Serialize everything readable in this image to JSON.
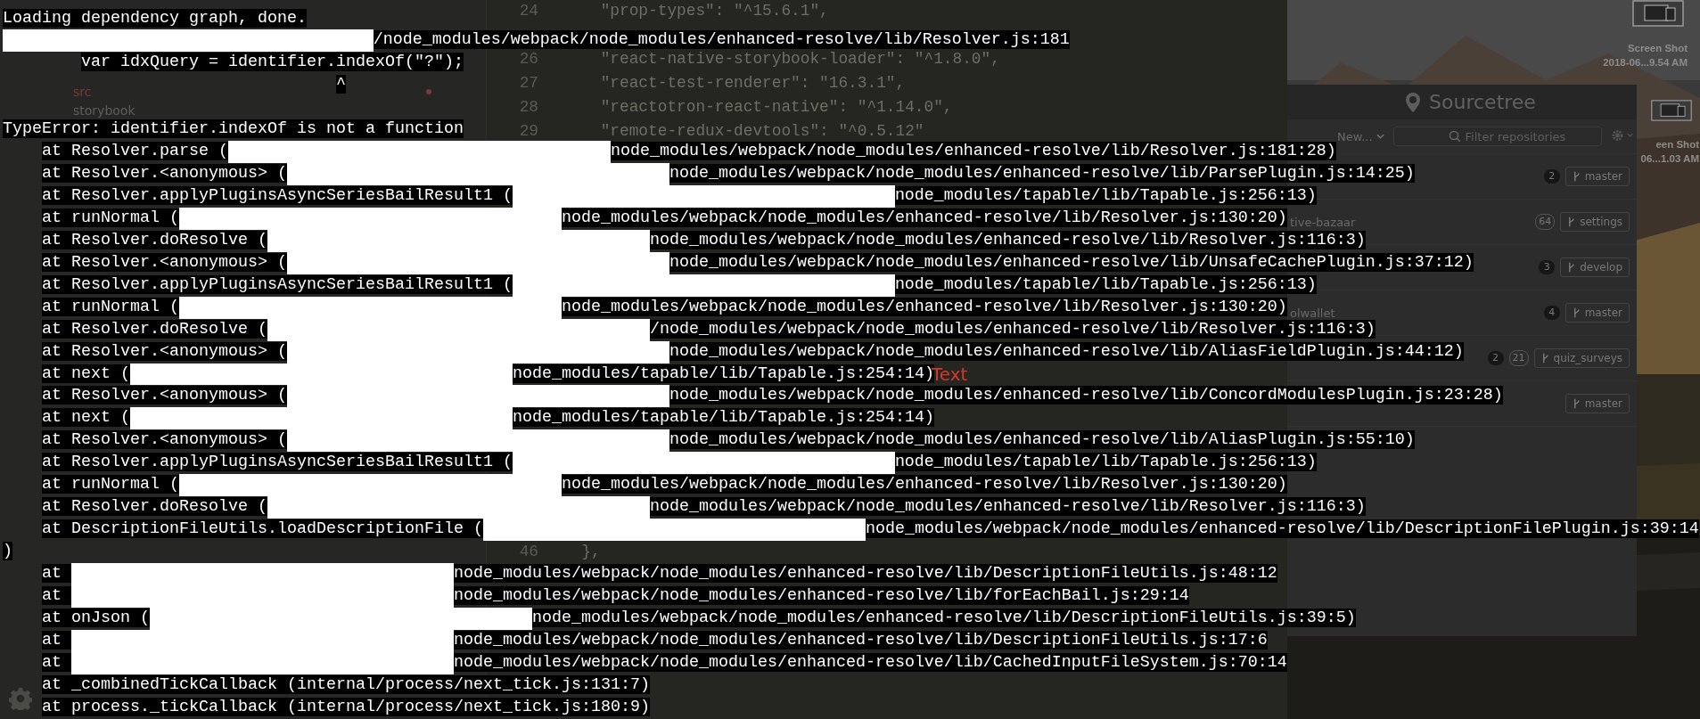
{
  "editor": {
    "file_tree": [
      {
        "name": "src",
        "modified": true
      },
      {
        "name": "storybook",
        "modified": false
      }
    ],
    "lines": [
      {
        "number": "24",
        "code": "    \"prop-types\": \"^15.6.1\","
      },
      {
        "number": "26",
        "code": "    \"react-native-storybook-loader\": \"^1.8.0\","
      },
      {
        "number": "27",
        "code": "    \"react-test-renderer\": \"16.3.1\","
      },
      {
        "number": "28",
        "code": "    \"reactotron-react-native\": \"^1.14.0\","
      },
      {
        "number": "29",
        "code": "    \"remote-redux-devtools\": \"^0.5.12\""
      }
    ],
    "lines_lower": [
      {
        "number": "46",
        "code": "  },"
      }
    ]
  },
  "desktop": {
    "files": [
      {
        "labels": [
          "Screen Shot",
          "2018-06...9.54 AM"
        ]
      },
      {
        "labels": [
          "een Shot",
          "06...1.03 AM"
        ]
      }
    ]
  },
  "sourcetree": {
    "title": "Sourcetree",
    "new_button": "New...",
    "search": {
      "placeholder": "Filter repositories"
    },
    "repositories": [
      {
        "badges": [
          {
            "kind": "filled",
            "text": "2"
          }
        ],
        "branch": "master"
      },
      {
        "name": "tive-bazaar",
        "badges": [
          {
            "kind": "outlined",
            "text": "64"
          }
        ],
        "branch": "settings"
      },
      {
        "badges": [
          {
            "kind": "filled",
            "text": "3"
          }
        ],
        "branch": "develop"
      },
      {
        "name": "olwallet",
        "badges": [
          {
            "kind": "filled",
            "text": "4"
          }
        ],
        "branch": "master"
      },
      {
        "badges": [
          {
            "kind": "filled",
            "text": "2"
          },
          {
            "kind": "outlined",
            "text": "21"
          }
        ],
        "branch": "quiz_surveys"
      },
      {
        "branch": "master"
      }
    ]
  },
  "terminal": {
    "lines": [
      {
        "kind": "output",
        "segments": [
          {
            "kind": "text",
            "text": "Loading dependency graph, done."
          }
        ]
      },
      {
        "kind": "output",
        "segments": [
          {
            "kind": "redacted"
          },
          {
            "kind": "text",
            "text": "/node_modules/webpack/node_modules/enhanced-resolve/lib/Resolver.js:181"
          }
        ]
      },
      {
        "kind": "output",
        "segments": [
          {
            "kind": "text",
            "text": "        var idxQuery = identifier.indexOf(\"?\");"
          }
        ]
      },
      {
        "kind": "output",
        "segments": [
          {
            "kind": "text",
            "text": "                                  ^"
          }
        ]
      },
      {
        "kind": "blank"
      },
      {
        "kind": "output",
        "segments": [
          {
            "kind": "text",
            "text": "TypeError: identifier.indexOf is not a function"
          }
        ]
      },
      {
        "kind": "output",
        "segments": [
          {
            "kind": "text",
            "text": "    at Resolver.parse ("
          },
          {
            "kind": "redacted"
          },
          {
            "kind": "text",
            "text": "node_modules/webpack/node_modules/enhanced-resolve/lib/Resolver.js:181:28)"
          }
        ]
      },
      {
        "kind": "output",
        "segments": [
          {
            "kind": "text",
            "text": "    at Resolver.<anonymous> ("
          },
          {
            "kind": "redacted"
          },
          {
            "kind": "text",
            "text": "node_modules/webpack/node_modules/enhanced-resolve/lib/ParsePlugin.js:14:25)"
          }
        ]
      },
      {
        "kind": "output",
        "segments": [
          {
            "kind": "text",
            "text": "    at Resolver.applyPluginsAsyncSeriesBailResult1 ("
          },
          {
            "kind": "redacted"
          },
          {
            "kind": "text",
            "text": "node_modules/tapable/lib/Tapable.js:256:13)"
          }
        ]
      },
      {
        "kind": "output",
        "segments": [
          {
            "kind": "text",
            "text": "    at runNormal ("
          },
          {
            "kind": "redacted"
          },
          {
            "kind": "text",
            "text": "node_modules/webpack/node_modules/enhanced-resolve/lib/Resolver.js:130:20)"
          }
        ]
      },
      {
        "kind": "output",
        "segments": [
          {
            "kind": "text",
            "text": "    at Resolver.doResolve ("
          },
          {
            "kind": "redacted"
          },
          {
            "kind": "text",
            "text": "node_modules/webpack/node_modules/enhanced-resolve/lib/Resolver.js:116:3)"
          }
        ]
      },
      {
        "kind": "output",
        "segments": [
          {
            "kind": "text",
            "text": "    at Resolver.<anonymous> ("
          },
          {
            "kind": "redacted"
          },
          {
            "kind": "text",
            "text": "node_modules/webpack/node_modules/enhanced-resolve/lib/UnsafeCachePlugin.js:37:12)"
          }
        ]
      },
      {
        "kind": "output",
        "segments": [
          {
            "kind": "text",
            "text": "    at Resolver.applyPluginsAsyncSeriesBailResult1 ("
          },
          {
            "kind": "redacted"
          },
          {
            "kind": "text",
            "text": "node_modules/tapable/lib/Tapable.js:256:13)"
          }
        ]
      },
      {
        "kind": "output",
        "segments": [
          {
            "kind": "text",
            "text": "    at runNormal ("
          },
          {
            "kind": "redacted"
          },
          {
            "kind": "text",
            "text": "node_modules/webpack/node_modules/enhanced-resolve/lib/Resolver.js:130:20)"
          }
        ]
      },
      {
        "kind": "output",
        "segments": [
          {
            "kind": "text",
            "text": "    at Resolver.doResolve ("
          },
          {
            "kind": "redacted"
          },
          {
            "kind": "text",
            "text": "/node_modules/webpack/node_modules/enhanced-resolve/lib/Resolver.js:116:3)"
          }
        ]
      },
      {
        "kind": "output",
        "segments": [
          {
            "kind": "text",
            "text": "    at Resolver.<anonymous> ("
          },
          {
            "kind": "redacted"
          },
          {
            "kind": "text",
            "text": "node_modules/webpack/node_modules/enhanced-resolve/lib/AliasFieldPlugin.js:44:12)"
          }
        ]
      },
      {
        "kind": "output",
        "segments": [
          {
            "kind": "text",
            "text": "    at next ("
          },
          {
            "kind": "redacted"
          },
          {
            "kind": "text",
            "text": "node_modules/tapable/lib/Tapable.js:254:14)"
          }
        ]
      },
      {
        "kind": "output",
        "segments": [
          {
            "kind": "text",
            "text": "    at Resolver.<anonymous> ("
          },
          {
            "kind": "redacted"
          },
          {
            "kind": "text",
            "text": "node_modules/webpack/node_modules/enhanced-resolve/lib/ConcordModulesPlugin.js:23:28)"
          }
        ]
      },
      {
        "kind": "output",
        "segments": [
          {
            "kind": "text",
            "text": "    at next ("
          },
          {
            "kind": "redacted"
          },
          {
            "kind": "text",
            "text": "node_modules/tapable/lib/Tapable.js:254:14)"
          }
        ]
      },
      {
        "kind": "output",
        "segments": [
          {
            "kind": "text",
            "text": "    at Resolver.<anonymous> ("
          },
          {
            "kind": "redacted"
          },
          {
            "kind": "text",
            "text": "node_modules/webpack/node_modules/enhanced-resolve/lib/AliasPlugin.js:55:10)"
          }
        ]
      },
      {
        "kind": "output",
        "segments": [
          {
            "kind": "text",
            "text": "    at Resolver.applyPluginsAsyncSeriesBailResult1 ("
          },
          {
            "kind": "redacted"
          },
          {
            "kind": "text",
            "text": "node_modules/tapable/lib/Tapable.js:256:13)"
          }
        ]
      },
      {
        "kind": "output",
        "segments": [
          {
            "kind": "text",
            "text": "    at runNormal ("
          },
          {
            "kind": "redacted"
          },
          {
            "kind": "text",
            "text": "node_modules/webpack/node_modules/enhanced-resolve/lib/Resolver.js:130:20)"
          }
        ]
      },
      {
        "kind": "output",
        "segments": [
          {
            "kind": "text",
            "text": "    at Resolver.doResolve ("
          },
          {
            "kind": "redacted"
          },
          {
            "kind": "text",
            "text": "node_modules/webpack/node_modules/enhanced-resolve/lib/Resolver.js:116:3)"
          }
        ]
      },
      {
        "kind": "output",
        "segments": [
          {
            "kind": "text",
            "text": "    at DescriptionFileUtils.loadDescriptionFile ("
          },
          {
            "kind": "redacted"
          },
          {
            "kind": "text",
            "text": "node_modules/webpack/node_modules/enhanced-resolve/lib/DescriptionFilePlugin.js:39:14"
          }
        ]
      },
      {
        "kind": "output",
        "segments": [
          {
            "kind": "text",
            "text": ")"
          }
        ]
      },
      {
        "kind": "output",
        "segments": [
          {
            "kind": "text",
            "text": "    at "
          },
          {
            "kind": "redacted"
          },
          {
            "kind": "text",
            "text": "node_modules/webpack/node_modules/enhanced-resolve/lib/DescriptionFileUtils.js:48:12"
          }
        ]
      },
      {
        "kind": "output",
        "segments": [
          {
            "kind": "text",
            "text": "    at "
          },
          {
            "kind": "redacted"
          },
          {
            "kind": "text",
            "text": "node_modules/webpack/node_modules/enhanced-resolve/lib/forEachBail.js:29:14"
          }
        ]
      },
      {
        "kind": "output",
        "segments": [
          {
            "kind": "text",
            "text": "    at onJson ("
          },
          {
            "kind": "redacted"
          },
          {
            "kind": "text",
            "text": "node_modules/webpack/node_modules/enhanced-resolve/lib/DescriptionFileUtils.js:39:5)"
          }
        ]
      },
      {
        "kind": "output",
        "segments": [
          {
            "kind": "text",
            "text": "    at "
          },
          {
            "kind": "redacted"
          },
          {
            "kind": "text",
            "text": "node_modules/webpack/node_modules/enhanced-resolve/lib/DescriptionFileUtils.js:17:6"
          }
        ]
      },
      {
        "kind": "output",
        "segments": [
          {
            "kind": "text",
            "text": "    at "
          },
          {
            "kind": "redacted"
          },
          {
            "kind": "text",
            "text": "node_modules/webpack/node_modules/enhanced-resolve/lib/CachedInputFileSystem.js:70:14"
          }
        ]
      },
      {
        "kind": "output",
        "segments": [
          {
            "kind": "text",
            "text": "    at _combinedTickCallback (internal/process/next_tick.js:131:7)"
          }
        ]
      },
      {
        "kind": "output",
        "segments": [
          {
            "kind": "text",
            "text": "    at process._tickCallback (internal/process/next_tick.js:180:9)"
          }
        ]
      }
    ]
  },
  "annotation": "Text"
}
